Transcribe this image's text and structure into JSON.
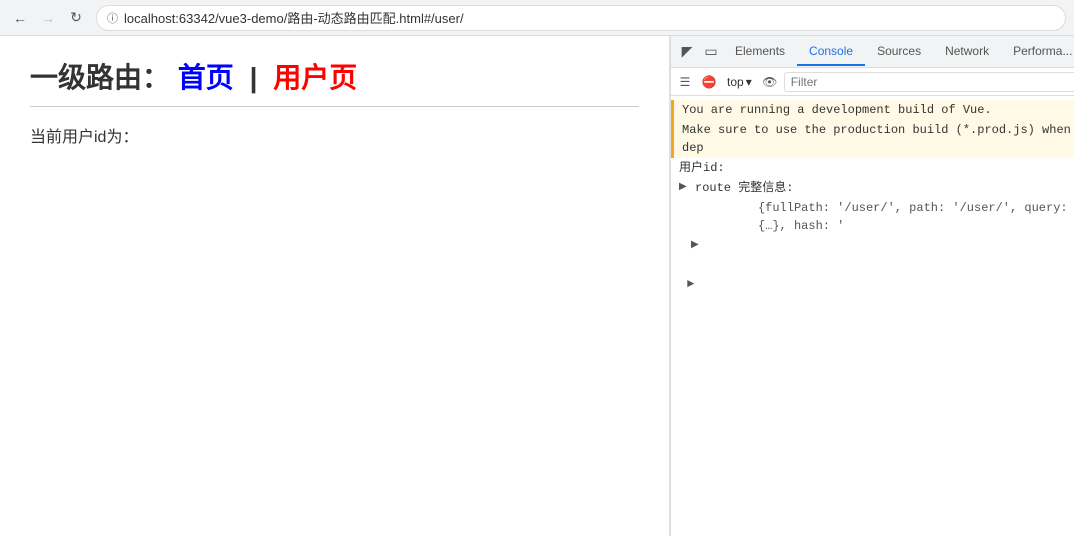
{
  "browser": {
    "url": "localhost:63342/vue3-demo/路由-动态路由匹配.html#/user/",
    "back_disabled": false,
    "forward_disabled": true
  },
  "page": {
    "title_label": "一级路由：",
    "link_home": "首页",
    "separator": "|",
    "link_user": "用户页",
    "user_id_label": "当前用户id为："
  },
  "devtools": {
    "tabs": [
      {
        "label": "Elements",
        "active": false
      },
      {
        "label": "Console",
        "active": true
      },
      {
        "label": "Sources",
        "active": false
      },
      {
        "label": "Network",
        "active": false
      },
      {
        "label": "Performa...",
        "active": false
      }
    ],
    "console_toolbar": {
      "top_label": "top",
      "filter_placeholder": "Filter"
    },
    "console_lines": [
      {
        "type": "warning",
        "text": "You are running a development build of Vue."
      },
      {
        "type": "warning",
        "text": "Make sure to use the production build (*.prod.js) when dep"
      },
      {
        "type": "info",
        "text": "用户id:"
      },
      {
        "type": "info",
        "text": "route 完整信息:"
      },
      {
        "type": "expandable",
        "text": "{fullPath: '/user/', path: '/user/', query: {…}, hash: '"
      }
    ]
  }
}
